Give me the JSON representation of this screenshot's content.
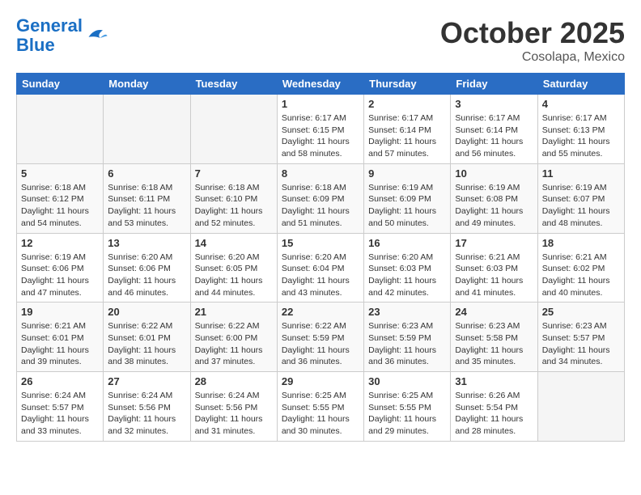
{
  "header": {
    "logo_line1": "General",
    "logo_line2": "Blue",
    "month": "October 2025",
    "location": "Cosolapa, Mexico"
  },
  "days_of_week": [
    "Sunday",
    "Monday",
    "Tuesday",
    "Wednesday",
    "Thursday",
    "Friday",
    "Saturday"
  ],
  "weeks": [
    [
      {
        "day": "",
        "info": ""
      },
      {
        "day": "",
        "info": ""
      },
      {
        "day": "",
        "info": ""
      },
      {
        "day": "1",
        "info": "Sunrise: 6:17 AM\nSunset: 6:15 PM\nDaylight: 11 hours\nand 58 minutes."
      },
      {
        "day": "2",
        "info": "Sunrise: 6:17 AM\nSunset: 6:14 PM\nDaylight: 11 hours\nand 57 minutes."
      },
      {
        "day": "3",
        "info": "Sunrise: 6:17 AM\nSunset: 6:14 PM\nDaylight: 11 hours\nand 56 minutes."
      },
      {
        "day": "4",
        "info": "Sunrise: 6:17 AM\nSunset: 6:13 PM\nDaylight: 11 hours\nand 55 minutes."
      }
    ],
    [
      {
        "day": "5",
        "info": "Sunrise: 6:18 AM\nSunset: 6:12 PM\nDaylight: 11 hours\nand 54 minutes."
      },
      {
        "day": "6",
        "info": "Sunrise: 6:18 AM\nSunset: 6:11 PM\nDaylight: 11 hours\nand 53 minutes."
      },
      {
        "day": "7",
        "info": "Sunrise: 6:18 AM\nSunset: 6:10 PM\nDaylight: 11 hours\nand 52 minutes."
      },
      {
        "day": "8",
        "info": "Sunrise: 6:18 AM\nSunset: 6:09 PM\nDaylight: 11 hours\nand 51 minutes."
      },
      {
        "day": "9",
        "info": "Sunrise: 6:19 AM\nSunset: 6:09 PM\nDaylight: 11 hours\nand 50 minutes."
      },
      {
        "day": "10",
        "info": "Sunrise: 6:19 AM\nSunset: 6:08 PM\nDaylight: 11 hours\nand 49 minutes."
      },
      {
        "day": "11",
        "info": "Sunrise: 6:19 AM\nSunset: 6:07 PM\nDaylight: 11 hours\nand 48 minutes."
      }
    ],
    [
      {
        "day": "12",
        "info": "Sunrise: 6:19 AM\nSunset: 6:06 PM\nDaylight: 11 hours\nand 47 minutes."
      },
      {
        "day": "13",
        "info": "Sunrise: 6:20 AM\nSunset: 6:06 PM\nDaylight: 11 hours\nand 46 minutes."
      },
      {
        "day": "14",
        "info": "Sunrise: 6:20 AM\nSunset: 6:05 PM\nDaylight: 11 hours\nand 44 minutes."
      },
      {
        "day": "15",
        "info": "Sunrise: 6:20 AM\nSunset: 6:04 PM\nDaylight: 11 hours\nand 43 minutes."
      },
      {
        "day": "16",
        "info": "Sunrise: 6:20 AM\nSunset: 6:03 PM\nDaylight: 11 hours\nand 42 minutes."
      },
      {
        "day": "17",
        "info": "Sunrise: 6:21 AM\nSunset: 6:03 PM\nDaylight: 11 hours\nand 41 minutes."
      },
      {
        "day": "18",
        "info": "Sunrise: 6:21 AM\nSunset: 6:02 PM\nDaylight: 11 hours\nand 40 minutes."
      }
    ],
    [
      {
        "day": "19",
        "info": "Sunrise: 6:21 AM\nSunset: 6:01 PM\nDaylight: 11 hours\nand 39 minutes."
      },
      {
        "day": "20",
        "info": "Sunrise: 6:22 AM\nSunset: 6:01 PM\nDaylight: 11 hours\nand 38 minutes."
      },
      {
        "day": "21",
        "info": "Sunrise: 6:22 AM\nSunset: 6:00 PM\nDaylight: 11 hours\nand 37 minutes."
      },
      {
        "day": "22",
        "info": "Sunrise: 6:22 AM\nSunset: 5:59 PM\nDaylight: 11 hours\nand 36 minutes."
      },
      {
        "day": "23",
        "info": "Sunrise: 6:23 AM\nSunset: 5:59 PM\nDaylight: 11 hours\nand 36 minutes."
      },
      {
        "day": "24",
        "info": "Sunrise: 6:23 AM\nSunset: 5:58 PM\nDaylight: 11 hours\nand 35 minutes."
      },
      {
        "day": "25",
        "info": "Sunrise: 6:23 AM\nSunset: 5:57 PM\nDaylight: 11 hours\nand 34 minutes."
      }
    ],
    [
      {
        "day": "26",
        "info": "Sunrise: 6:24 AM\nSunset: 5:57 PM\nDaylight: 11 hours\nand 33 minutes."
      },
      {
        "day": "27",
        "info": "Sunrise: 6:24 AM\nSunset: 5:56 PM\nDaylight: 11 hours\nand 32 minutes."
      },
      {
        "day": "28",
        "info": "Sunrise: 6:24 AM\nSunset: 5:56 PM\nDaylight: 11 hours\nand 31 minutes."
      },
      {
        "day": "29",
        "info": "Sunrise: 6:25 AM\nSunset: 5:55 PM\nDaylight: 11 hours\nand 30 minutes."
      },
      {
        "day": "30",
        "info": "Sunrise: 6:25 AM\nSunset: 5:55 PM\nDaylight: 11 hours\nand 29 minutes."
      },
      {
        "day": "31",
        "info": "Sunrise: 6:26 AM\nSunset: 5:54 PM\nDaylight: 11 hours\nand 28 minutes."
      },
      {
        "day": "",
        "info": ""
      }
    ]
  ]
}
